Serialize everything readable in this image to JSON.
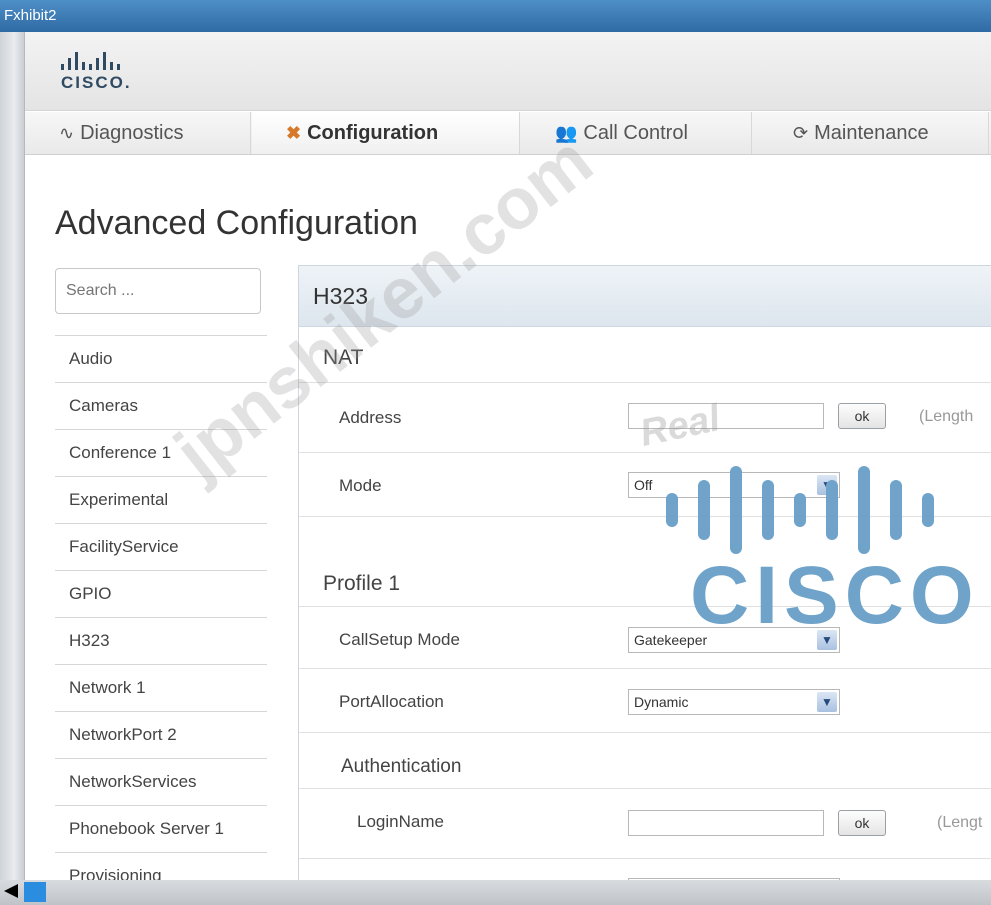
{
  "window": {
    "title": "Fxhibit2"
  },
  "brand": {
    "logo_text": "CISCO."
  },
  "nav": {
    "tabs": [
      {
        "icon": "pulse-icon",
        "label": "Diagnostics"
      },
      {
        "icon": "tools-icon",
        "label": "Configuration"
      },
      {
        "icon": "people-icon",
        "label": "Call Control"
      },
      {
        "icon": "refresh-icon",
        "label": "Maintenance"
      }
    ],
    "active_tab": "Configuration"
  },
  "page": {
    "title": "Advanced Configuration"
  },
  "search": {
    "placeholder": "Search ..."
  },
  "sidebar": {
    "items": [
      {
        "label": "Audio"
      },
      {
        "label": "Cameras"
      },
      {
        "label": "Conference 1"
      },
      {
        "label": "Experimental"
      },
      {
        "label": "FacilityService"
      },
      {
        "label": "GPIO"
      },
      {
        "label": "H323"
      },
      {
        "label": "Network 1"
      },
      {
        "label": "NetworkPort 2"
      },
      {
        "label": "NetworkServices"
      },
      {
        "label": "Phonebook Server 1"
      },
      {
        "label": "Provisioning"
      }
    ]
  },
  "panel": {
    "title": "H323",
    "nat": {
      "heading": "NAT",
      "address": {
        "label": "Address",
        "value": "",
        "ok": "ok",
        "hint": "(Length"
      },
      "mode": {
        "label": "Mode",
        "value": "Off"
      }
    },
    "profile": {
      "heading": "Profile 1",
      "callsetup": {
        "label": "CallSetup Mode",
        "value": "Gatekeeper"
      },
      "portallocation": {
        "label": "PortAllocation",
        "value": "Dynamic"
      },
      "authentication": {
        "heading": "Authentication",
        "loginname": {
          "label": "LoginName",
          "value": "",
          "ok": "ok",
          "hint": "(Lengt"
        }
      }
    }
  },
  "watermark": {
    "site": "jpnshiken.com",
    "word": "Real",
    "logo_text": "CISCO"
  }
}
